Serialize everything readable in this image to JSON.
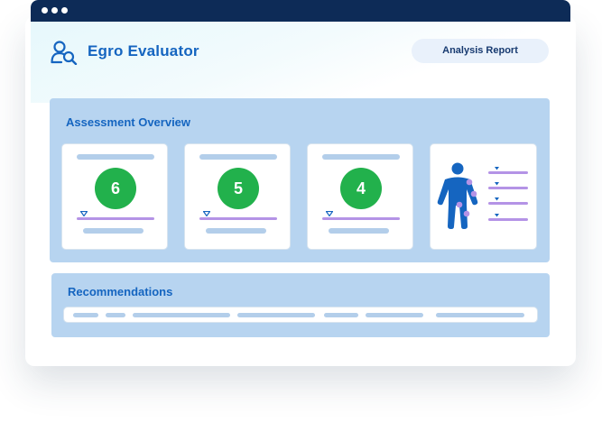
{
  "app": {
    "title": "Egro Evaluator"
  },
  "header": {
    "report_button_label": "Analysis Report"
  },
  "overview": {
    "title": "Assessment Overview",
    "scores": [
      {
        "value": "6",
        "color": "#22b14c"
      },
      {
        "value": "5",
        "color": "#22b14c"
      },
      {
        "value": "4",
        "color": "#22b14c"
      }
    ]
  },
  "recommendations": {
    "title": "Recommendations"
  },
  "icons": {
    "app_icon": "user-search-icon",
    "body_figure": "human-figure-icon",
    "window_controls": "window-dots"
  },
  "colors": {
    "titlebar": "#0d2b57",
    "accent": "#1565c0",
    "score_badge": "#22b14c",
    "panel": "#b7d4f0",
    "indicator": "#b493e6"
  }
}
